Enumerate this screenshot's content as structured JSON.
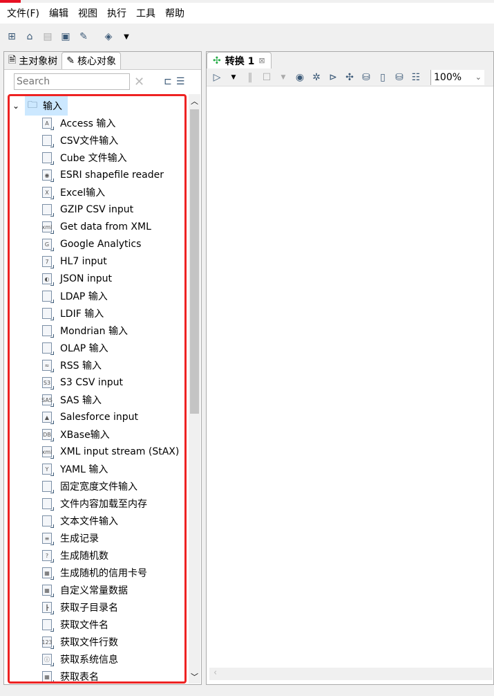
{
  "menu": [
    "文件(F)",
    "编辑",
    "视图",
    "执行",
    "工具",
    "帮助"
  ],
  "toolbar": {
    "icons": [
      "new-file-icon",
      "open-icon",
      "explore-icon",
      "save-icon",
      "save-as-icon",
      "layers-icon",
      "dropdown-icon"
    ]
  },
  "left": {
    "tabs": [
      {
        "label": "主对象树",
        "icon": "tree-icon"
      },
      {
        "label": "核心对象",
        "icon": "pencil-icon"
      }
    ],
    "search_placeholder": "Search",
    "folder": "输入",
    "items": [
      {
        "label": "Access 输入",
        "badge": "A"
      },
      {
        "label": "CSV文件输入",
        "badge": ""
      },
      {
        "label": "Cube 文件输入",
        "badge": ""
      },
      {
        "label": "ESRI shapefile reader",
        "badge": "◉"
      },
      {
        "label": "Excel输入",
        "badge": "X"
      },
      {
        "label": "GZIP CSV input",
        "badge": ""
      },
      {
        "label": "Get data from XML",
        "badge": "xml"
      },
      {
        "label": "Google Analytics",
        "badge": "G"
      },
      {
        "label": "HL7 input",
        "badge": "7"
      },
      {
        "label": "JSON input",
        "badge": "◐"
      },
      {
        "label": "LDAP 输入",
        "badge": ""
      },
      {
        "label": "LDIF 输入",
        "badge": ""
      },
      {
        "label": "Mondrian 输入",
        "badge": ""
      },
      {
        "label": "OLAP 输入",
        "badge": ""
      },
      {
        "label": "RSS 输入",
        "badge": "≈"
      },
      {
        "label": "S3 CSV input",
        "badge": "S3"
      },
      {
        "label": "SAS 输入",
        "badge": "SAS"
      },
      {
        "label": "Salesforce input",
        "badge": "▲"
      },
      {
        "label": "XBase输入",
        "badge": "DB"
      },
      {
        "label": "XML input stream (StAX)",
        "badge": "xml"
      },
      {
        "label": "YAML 输入",
        "badge": "Y"
      },
      {
        "label": "固定宽度文件输入",
        "badge": ""
      },
      {
        "label": "文件内容加载至内存",
        "badge": ""
      },
      {
        "label": "文本文件输入",
        "badge": ""
      },
      {
        "label": "生成记录",
        "badge": "≡"
      },
      {
        "label": "生成随机数",
        "badge": "?"
      },
      {
        "label": "生成随机的信用卡号",
        "badge": "▦"
      },
      {
        "label": "自定义常量数据",
        "badge": "▦"
      },
      {
        "label": "获取子目录名",
        "badge": "┣"
      },
      {
        "label": "获取文件名",
        "badge": ""
      },
      {
        "label": "获取文件行数",
        "badge": "123"
      },
      {
        "label": "获取系统信息",
        "badge": "ⓘ"
      },
      {
        "label": "获取表名",
        "badge": "▦"
      }
    ]
  },
  "right": {
    "tab": "转换 1",
    "zoom": "100%"
  },
  "colors": {
    "highlight": "#ee2222",
    "selection": "#cce8ff",
    "icon": "#3c5a78",
    "tab_icon": "#22aa44"
  }
}
